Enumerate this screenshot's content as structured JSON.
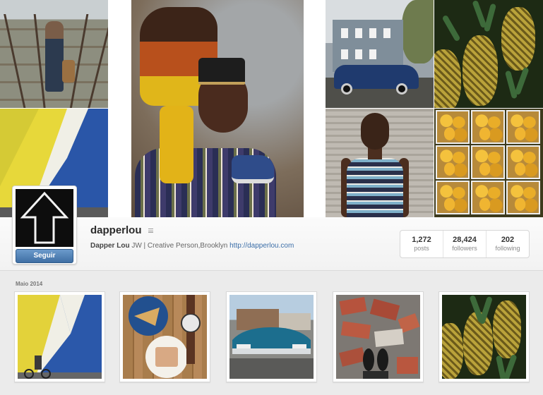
{
  "profile": {
    "username": "dapperlou",
    "follow_label": "Seguir",
    "bio_name": "Dapper Lou",
    "bio_text": " JW | Creative Person,Brooklyn ",
    "bio_link": "http://dapperlou.com"
  },
  "stats": [
    {
      "value": "1,272",
      "label": "posts"
    },
    {
      "value": "28,424",
      "label": "followers"
    },
    {
      "value": "202",
      "label": "following"
    }
  ],
  "feed": {
    "month_label": "Maio 2014"
  },
  "icons": {
    "avatar": "up-arrow-icon",
    "menu": "menu-icon"
  },
  "colors": {
    "follow_button": "#4a7bb0",
    "link": "#3b6ea8",
    "background": "#ececec"
  }
}
